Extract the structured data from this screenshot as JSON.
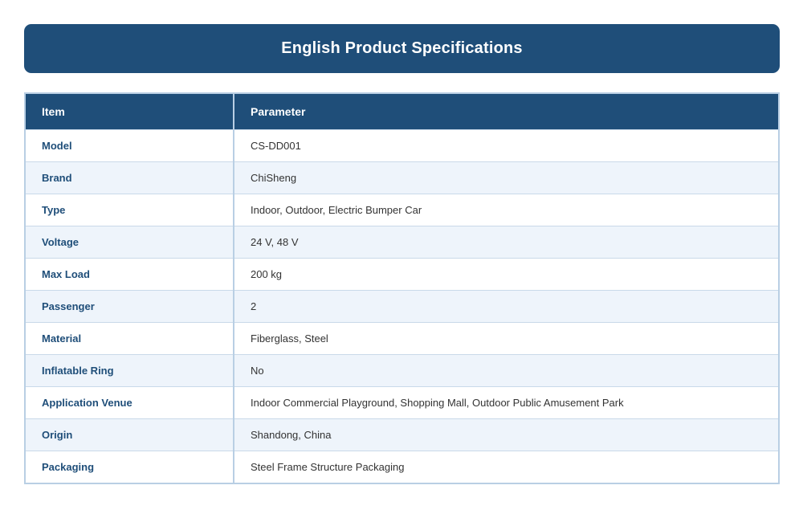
{
  "title": "English Product Specifications",
  "table": {
    "headers": [
      "Item",
      "Parameter"
    ],
    "rows": [
      {
        "item": "Model",
        "parameter": "CS-DD001"
      },
      {
        "item": "Brand",
        "parameter": "ChiSheng"
      },
      {
        "item": "Type",
        "parameter": "Indoor, Outdoor, Electric Bumper Car"
      },
      {
        "item": "Voltage",
        "parameter": "24 V, 48 V"
      },
      {
        "item": "Max Load",
        "parameter": "200 kg"
      },
      {
        "item": "Passenger",
        "parameter": "2"
      },
      {
        "item": "Material",
        "parameter": "Fiberglass, Steel"
      },
      {
        "item": "Inflatable Ring",
        "parameter": "No"
      },
      {
        "item": "Application Venue",
        "parameter": "Indoor Commercial Playground, Shopping Mall, Outdoor Public Amusement Park"
      },
      {
        "item": "Origin",
        "parameter": "Shandong, China"
      },
      {
        "item": "Packaging",
        "parameter": "Steel Frame Structure Packaging"
      }
    ]
  },
  "colors": {
    "header_bg": "#1f4e79",
    "row_alt_bg": "#eef4fb",
    "item_text": "#1f4e79",
    "border": "#b9cfe4"
  }
}
